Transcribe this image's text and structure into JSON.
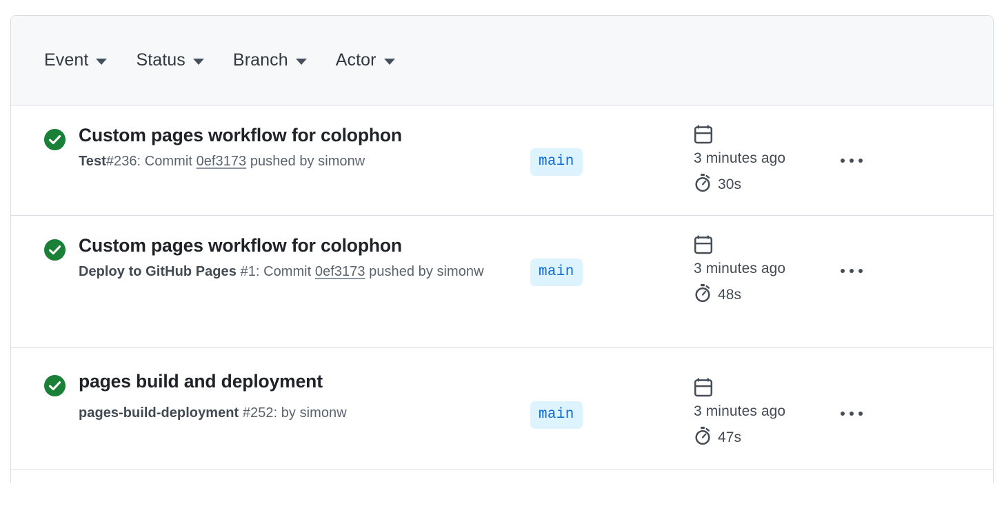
{
  "filters": [
    {
      "label": "Event",
      "icon": "chevron-down-icon"
    },
    {
      "label": "Status",
      "icon": "chevron-down-icon"
    },
    {
      "label": "Branch",
      "icon": "chevron-down-icon"
    },
    {
      "label": "Actor",
      "icon": "chevron-down-icon"
    }
  ],
  "colors": {
    "success_green": "#1a7f37",
    "branch_badge_bg": "#ddf4ff",
    "branch_badge_text": "#0969da",
    "header_bg": "#f6f8fa",
    "border": "#d8dee4",
    "title_text": "#1f2328",
    "muted_text": "#59636e"
  },
  "icons": {
    "status": "check-circle-icon",
    "calendar": "calendar-icon",
    "duration": "stopwatch-icon",
    "menu": "kebab-horizontal-icon"
  },
  "runs": [
    {
      "status": "success",
      "title": "Custom pages workflow for colophon",
      "workflow_name": "Test",
      "run_number": "#236",
      "trigger_prefix": ": Commit ",
      "commit_sha": "0ef3173",
      "trigger_suffix": " pushed by simonw",
      "branch": "main",
      "when": "3 minutes ago",
      "duration": "30s",
      "menu_label": "..."
    },
    {
      "status": "success",
      "title": "Custom pages workflow for colophon",
      "workflow_name": "Deploy to GitHub Pages",
      "run_number": "#1",
      "trigger_prefix": ": Commit ",
      "commit_sha": "0ef3173",
      "trigger_suffix": " pushed by simonw",
      "branch": "main",
      "when": "3 minutes ago",
      "duration": "48s",
      "menu_label": "..."
    },
    {
      "status": "success",
      "title": "pages build and deployment",
      "workflow_name": "pages-build-deployment",
      "run_number": "#252",
      "trigger_prefix": ": by simonw",
      "commit_sha": "",
      "trigger_suffix": "",
      "branch": "main",
      "when": "3 minutes ago",
      "duration": "47s",
      "menu_label": "..."
    }
  ]
}
